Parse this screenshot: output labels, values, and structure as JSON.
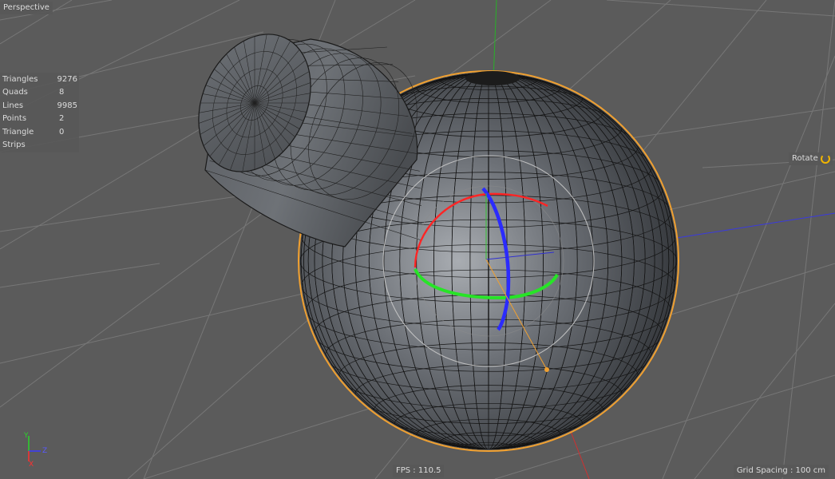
{
  "viewport": {
    "view_name": "Perspective",
    "fps": "FPS : 110.5",
    "grid_spacing": "Grid Spacing : 100 cm",
    "tool_label": "Rotate"
  },
  "stats": [
    {
      "label": "Triangles",
      "value": "9276"
    },
    {
      "label": "Quads",
      "value": "8"
    },
    {
      "label": "Lines",
      "value": "9985"
    },
    {
      "label": "Points",
      "value": "2"
    },
    {
      "label": "Triangle Strips",
      "value": "0"
    }
  ],
  "axis_indicator": {
    "x": "X",
    "y": "Y",
    "z": "Z"
  },
  "colors": {
    "background": "#5b5b5b",
    "grid": "#7a7a7a",
    "object_shading": "#666a70",
    "wireframe": "#101010",
    "selection": "#f0a030",
    "axis_x": "#ff2020",
    "axis_y": "#20e020",
    "axis_z": "#2020ff",
    "tool_accent": "#f0b400"
  }
}
